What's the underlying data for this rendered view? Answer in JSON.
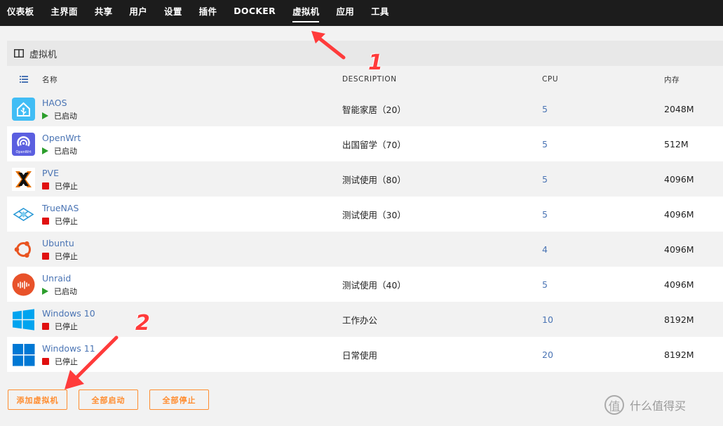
{
  "nav": {
    "items": [
      "仪表板",
      "主界面",
      "共享",
      "用户",
      "设置",
      "插件",
      "DOCKER",
      "虚拟机",
      "应用",
      "工具"
    ],
    "active": "虚拟机"
  },
  "panel": {
    "title": "虚拟机"
  },
  "table": {
    "headers": {
      "name": "名称",
      "description": "DESCRIPTION",
      "cpu": "CPU",
      "memory": "内存"
    },
    "rows": [
      {
        "name": "HAOS",
        "status": "已启动",
        "running": true,
        "description": "智能家居（20）",
        "cpu": "5",
        "memory": "2048M",
        "logo": "home-assistant-logo"
      },
      {
        "name": "OpenWrt",
        "status": "已启动",
        "running": true,
        "description": "出国留学（70）",
        "cpu": "5",
        "memory": "512M",
        "logo": "openwrt-logo",
        "logo_text": "OpenWrt"
      },
      {
        "name": "PVE",
        "status": "已停止",
        "running": false,
        "description": "测试使用（80）",
        "cpu": "5",
        "memory": "4096M",
        "logo": "proxmox-logo"
      },
      {
        "name": "TrueNAS",
        "status": "已停止",
        "running": false,
        "description": "测试使用（30）",
        "cpu": "5",
        "memory": "4096M",
        "logo": "truenas-logo"
      },
      {
        "name": "Ubuntu",
        "status": "已停止",
        "running": false,
        "description": "",
        "cpu": "4",
        "memory": "4096M",
        "logo": "ubuntu-logo"
      },
      {
        "name": "Unraid",
        "status": "已启动",
        "running": true,
        "description": "测试使用（40）",
        "cpu": "5",
        "memory": "4096M",
        "logo": "unraid-logo"
      },
      {
        "name": "Windows 10",
        "status": "已停止",
        "running": false,
        "description": "工作办公",
        "cpu": "10",
        "memory": "8192M",
        "logo": "windows10-logo"
      },
      {
        "name": "Windows 11",
        "status": "已停止",
        "running": false,
        "description": "日常使用",
        "cpu": "20",
        "memory": "8192M",
        "logo": "windows11-logo"
      }
    ]
  },
  "buttons": {
    "add": "添加虚拟机",
    "start_all": "全部启动",
    "stop_all": "全部停止"
  },
  "annotations": {
    "one": "1",
    "two": "2"
  },
  "watermark": {
    "symbol": "值",
    "text": "什么值得买"
  },
  "colors": {
    "accent": "#ff8c2f",
    "link": "#4a74b4",
    "running": "#2c9e2c",
    "stopped": "#e01010",
    "annotation": "#ff3b3b"
  }
}
